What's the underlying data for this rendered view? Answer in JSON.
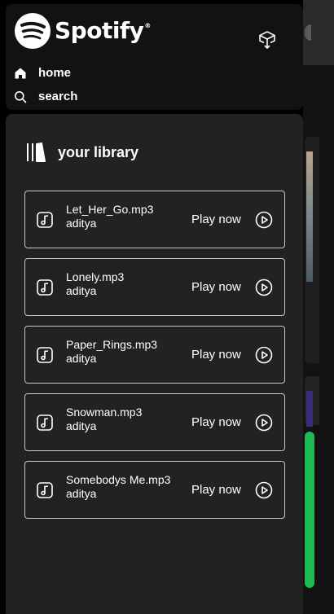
{
  "brand": {
    "name": "Spotify",
    "registered": "®"
  },
  "nav": {
    "items": [
      {
        "label": "home",
        "icon": "home-icon"
      },
      {
        "label": "search",
        "icon": "search-icon"
      }
    ],
    "install_icon": "install-app-icon"
  },
  "library": {
    "title": "your library",
    "icon": "library-icon",
    "songs": [
      {
        "title": "Let_Her_Go.mp3",
        "artist": "aditya",
        "action": "Play now"
      },
      {
        "title": "Lonely.mp3",
        "artist": "aditya",
        "action": "Play now"
      },
      {
        "title": "Paper_Rings.mp3",
        "artist": "aditya",
        "action": "Play now"
      },
      {
        "title": "Snowman.mp3",
        "artist": "aditya",
        "action": "Play now"
      },
      {
        "title": "Somebodys Me.mp3",
        "artist": "aditya",
        "action": "Play now"
      }
    ]
  },
  "colors": {
    "background": "#000000",
    "panel": "#121212",
    "library_panel": "#222222",
    "accent_green": "#1db954",
    "card_border": "#c8c8c8"
  }
}
